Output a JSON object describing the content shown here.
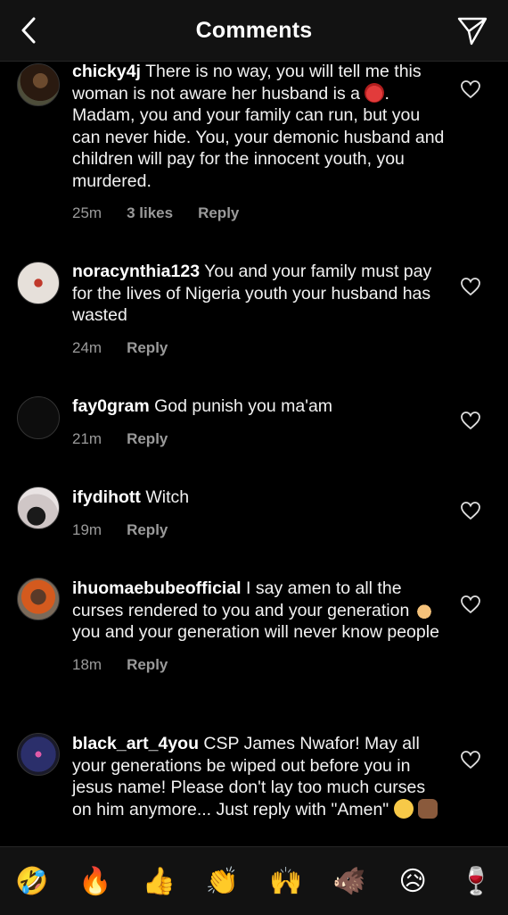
{
  "header": {
    "title": "Comments",
    "back_icon": "chevron-left-icon",
    "send_icon": "paper-plane-icon"
  },
  "comments": [
    {
      "username": "chicky4j",
      "text_before": "There is no way, you will tell me this woman is not aware her husband is a",
      "inline_emoji": "devil-face-emoji",
      "text_after": ". Madam, you and your family can run, but you can never hide. You, your demonic husband and children will pay for the innocent youth, you murdered.",
      "time": "25m",
      "likes": "3 likes",
      "reply": "Reply"
    },
    {
      "username": "noracynthia123",
      "text": "You and your family must pay for the lives of Nigeria youth your husband has wasted",
      "time": "24m",
      "reply": "Reply"
    },
    {
      "username": "fay0gram",
      "text": "God punish you ma'am",
      "time": "21m",
      "reply": "Reply"
    },
    {
      "username": "ifydihott",
      "text": "Witch",
      "time": "19m",
      "reply": "Reply"
    },
    {
      "username": "ihuomaebubeofficial",
      "text_before": "I say amen to all the curses rendered to you and your generation",
      "inline_emoji": "folded-hands-emoji",
      "text_after": " you and your generation will never know people",
      "time": "18m",
      "reply": "Reply"
    },
    {
      "username": "black_art_4you",
      "text": "CSP James Nwafor! May all your generations be wiped out before you in jesus name! Please don't lay too much curses on him anymore... Just reply with \"Amen\"",
      "inline_emojis": [
        "expressionless-face-emoji",
        "raised-fist-emoji"
      ]
    }
  ],
  "emoji_bar": [
    {
      "name": "rolling-laughing-emoji",
      "glyph": "🤣"
    },
    {
      "name": "fire-emoji",
      "glyph": "🔥"
    },
    {
      "name": "thumbs-up-emoji",
      "glyph": "👍"
    },
    {
      "name": "clapping-hands-emoji",
      "glyph": "👏"
    },
    {
      "name": "raising-hands-emoji",
      "glyph": "🙌"
    },
    {
      "name": "boar-emoji",
      "glyph": "🐗"
    },
    {
      "name": "sad-relieved-face-emoji",
      "glyph": "😥"
    },
    {
      "name": "wine-glass-emoji",
      "glyph": "🍷"
    }
  ],
  "colors": {
    "background": "#000000",
    "header_bg": "#121212",
    "meta_text": "#9a9a9a"
  }
}
